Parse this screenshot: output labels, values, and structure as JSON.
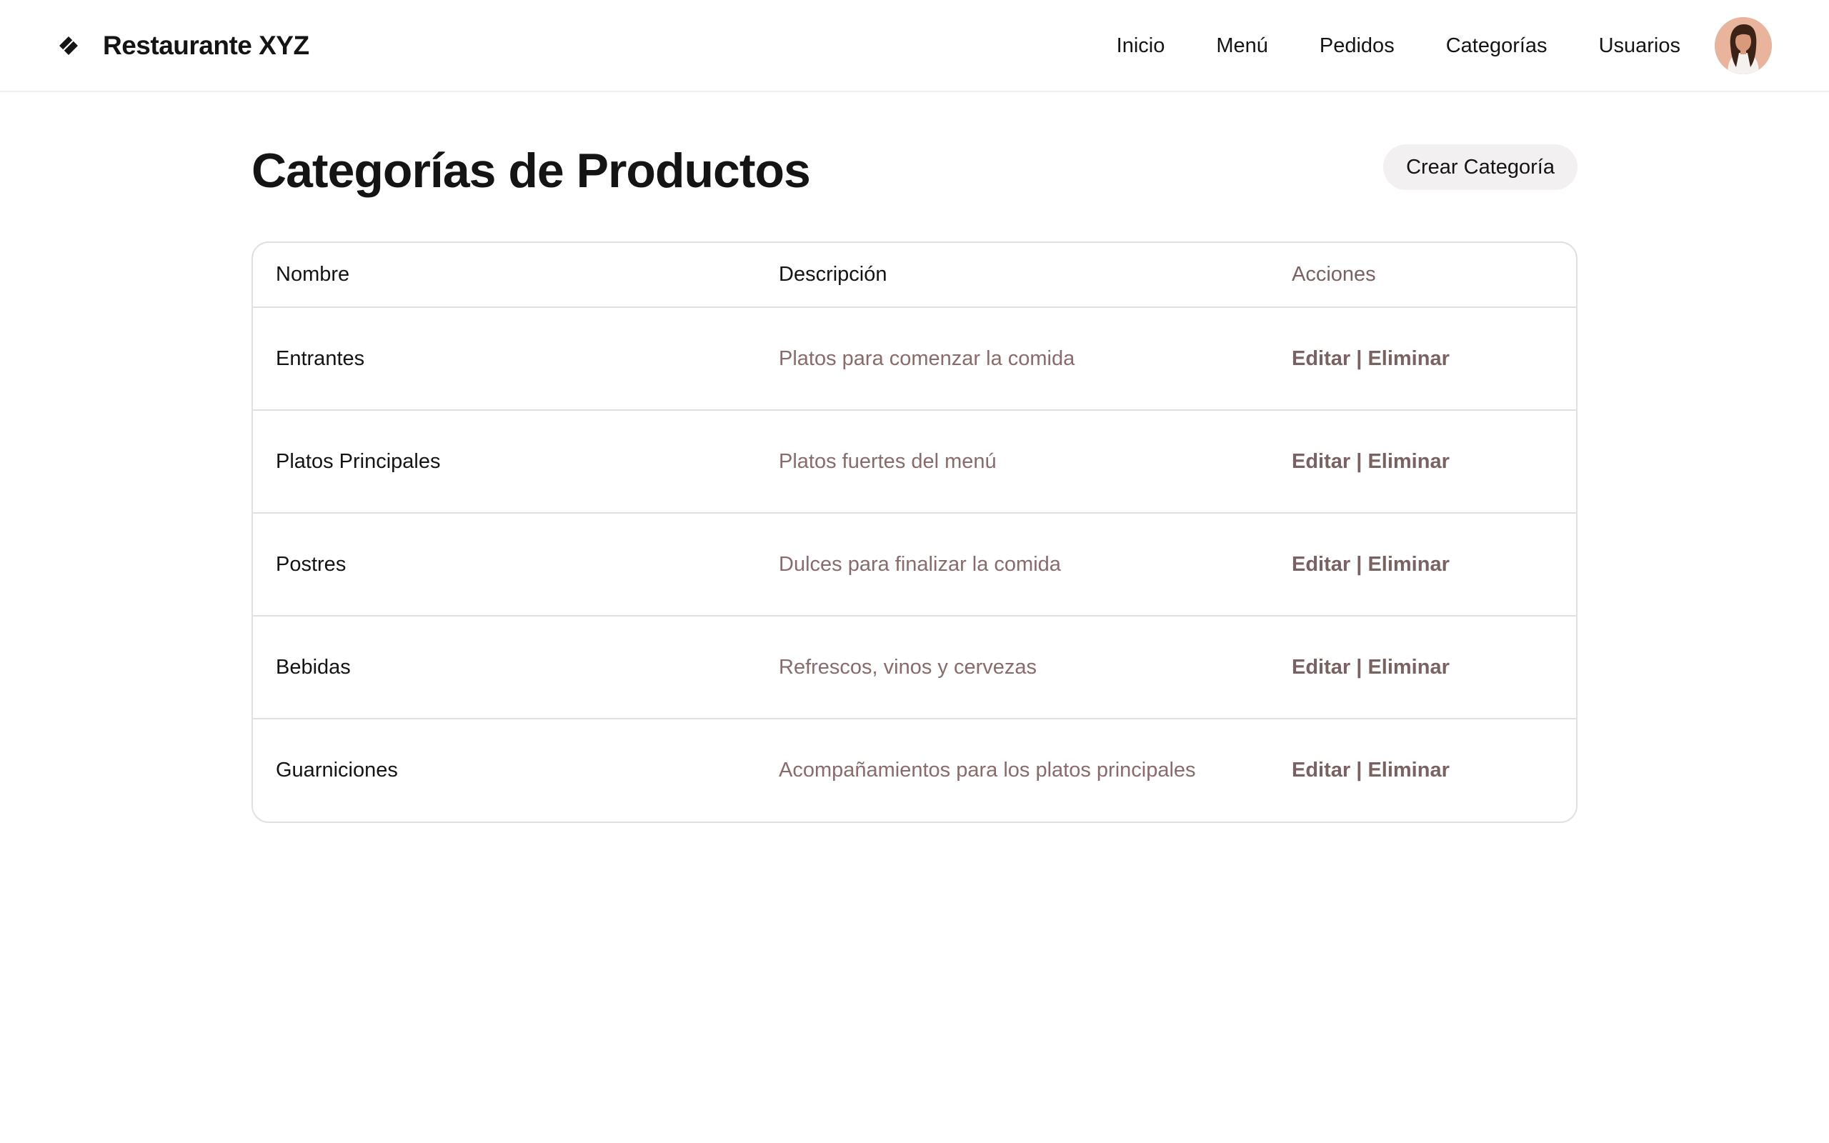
{
  "header": {
    "brand": "Restaurante XYZ",
    "brand_icon": "diamond-logo-icon",
    "nav": [
      "Inicio",
      "Menú",
      "Pedidos",
      "Categorías",
      "Usuarios"
    ],
    "avatar_icon": "user-avatar"
  },
  "page": {
    "title": "Categorías de Productos",
    "create_label": "Crear Categoría"
  },
  "table": {
    "columns": [
      "Nombre",
      "Descripción",
      "Acciones"
    ],
    "rows": [
      {
        "name": "Entrantes",
        "description": "Platos para comenzar la comida",
        "edit": "Editar",
        "separator": "|",
        "delete": "Eliminar"
      },
      {
        "name": "Platos Principales",
        "description": "Platos fuertes del menú",
        "edit": "Editar",
        "separator": "|",
        "delete": "Eliminar"
      },
      {
        "name": "Postres",
        "description": "Dulces para finalizar la comida",
        "edit": "Editar",
        "separator": "|",
        "delete": "Eliminar"
      },
      {
        "name": "Bebidas",
        "description": "Refrescos, vinos y cervezas",
        "edit": "Editar",
        "separator": "|",
        "delete": "Eliminar"
      },
      {
        "name": "Guarniciones",
        "description": "Acompañamientos para los platos principales",
        "edit": "Editar",
        "separator": "|",
        "delete": "Eliminar"
      }
    ]
  },
  "colors": {
    "text": "#141414",
    "muted": "#7a6262",
    "description": "#8a6b6b",
    "border": "#e2dfdf",
    "button_bg": "#f2f0f0"
  }
}
